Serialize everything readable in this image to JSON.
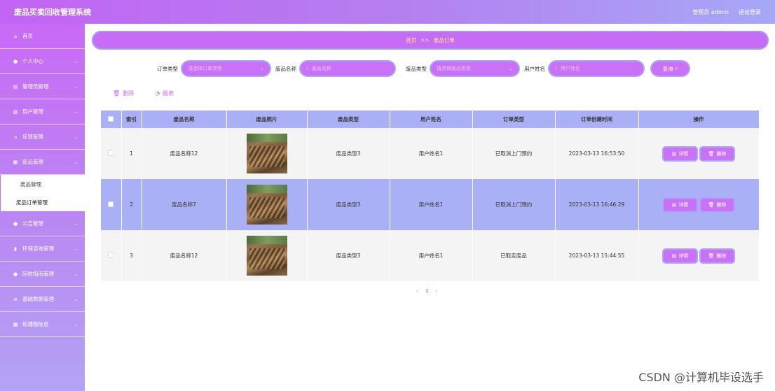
{
  "app": {
    "title": "废品买卖回收管理系统"
  },
  "topbar": {
    "user": "管理员 admin",
    "logout": "退出登录"
  },
  "sidebar": {
    "items": [
      {
        "label": "首页",
        "icon": "home-icon",
        "glyph": "⌂"
      },
      {
        "label": "个人中心",
        "icon": "user-icon",
        "glyph": "●"
      },
      {
        "label": "管理员管理",
        "icon": "card-icon",
        "glyph": "▤"
      },
      {
        "label": "用户管理",
        "icon": "bars-icon",
        "glyph": "▥"
      },
      {
        "label": "反馈管理",
        "icon": "bank-icon",
        "glyph": "⌂"
      },
      {
        "label": "废品管理",
        "icon": "grid-icon",
        "glyph": "▦"
      }
    ],
    "sub_items": [
      {
        "label": "废品管理"
      },
      {
        "label": "废品订单管理"
      }
    ],
    "items_after": [
      {
        "label": "公告管理",
        "icon": "user-icon",
        "glyph": "●"
      },
      {
        "label": "环保咨询管理",
        "icon": "chart-icon",
        "glyph": "▮"
      },
      {
        "label": "回收指南管理",
        "icon": "user-icon",
        "glyph": "●"
      },
      {
        "label": "基础数据管理",
        "icon": "database-icon",
        "glyph": "≡"
      },
      {
        "label": "轮播图信息",
        "icon": "grid-icon",
        "glyph": "▦"
      }
    ]
  },
  "breadcrumb": {
    "home": "首页",
    "sep": ">>",
    "current": "废品订单"
  },
  "filters": {
    "order_type_label": "订单类型",
    "order_type_placeholder": "请选择订单类型",
    "waste_name_label": "废品名称",
    "waste_name_placeholder": "废品名称",
    "waste_type_label": "废品类型",
    "waste_type_placeholder": "请选择废品类型",
    "user_name_label": "用户姓名",
    "user_name_placeholder": "用户姓名",
    "search_label": "查询"
  },
  "actions": {
    "delete": "删除",
    "report": "报表"
  },
  "table": {
    "headers": [
      "索引",
      "废品名称",
      "废品照片",
      "废品类型",
      "用户姓名",
      "订单类型",
      "订单创建时间",
      "操作"
    ],
    "rows": [
      {
        "index": "1",
        "name": "废品名称12",
        "type": "废品类型3",
        "user": "用户姓名1",
        "order_type": "已取消上门预约",
        "created": "2023-03-13 16:53:50"
      },
      {
        "index": "2",
        "name": "废品名称7",
        "type": "废品类型3",
        "user": "用户姓名1",
        "order_type": "已取消上门预约",
        "created": "2023-03-13 16:46:29"
      },
      {
        "index": "3",
        "name": "废品名称12",
        "type": "废品类型3",
        "user": "用户姓名1",
        "order_type": "已取走废品",
        "created": "2023-03-13 15:44:55"
      }
    ],
    "detail_label": "详情",
    "delete_label": "删除"
  },
  "pager": {
    "prev": "‹",
    "current": "1",
    "next": "›"
  },
  "watermark": "CSDN @计算机毕设选手"
}
